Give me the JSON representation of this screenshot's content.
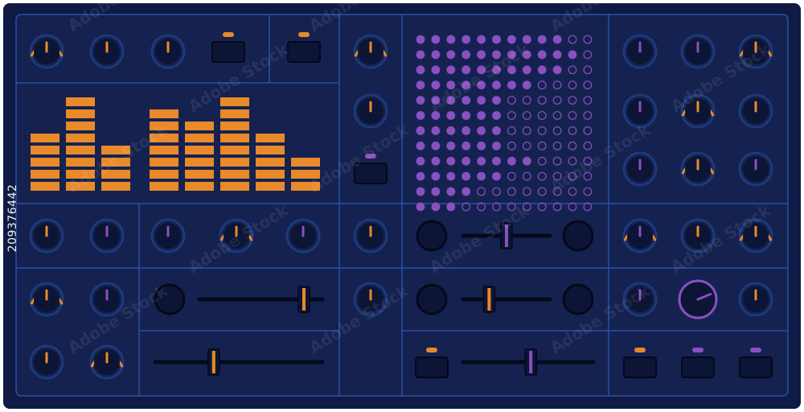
{
  "stock_id": "209376442",
  "watermark": "Adobe Stock",
  "colors": {
    "panel": "#152250",
    "frame": "#0f1b45",
    "line": "#2a4fa8",
    "knob_ring": "#1c3a7c",
    "knob_body": "#0c1535",
    "orange": "#e88a2a",
    "purple": "#8a50c0",
    "slider_track": "#06091c"
  },
  "equalizer": {
    "levels": [
      5,
      8,
      4,
      7,
      6,
      8,
      5,
      3
    ],
    "max_segments": 8
  },
  "matrix": {
    "rows": 12,
    "cols": 12,
    "filled_per_row": [
      10,
      11,
      10,
      8,
      6,
      6,
      6,
      6,
      8,
      6,
      4,
      3
    ]
  },
  "knobs": [
    {
      "id": "k1",
      "accent": "orange",
      "value": 0.5
    },
    {
      "id": "k2",
      "accent": "orange",
      "value": 0.5
    },
    {
      "id": "k3",
      "accent": "orange",
      "value": 0.5
    },
    {
      "id": "k4",
      "accent": "orange",
      "value": 0.5
    },
    {
      "id": "k5",
      "accent": "orange",
      "value": 0.5
    },
    {
      "id": "k6",
      "accent": "purple",
      "value": 0.5
    },
    {
      "id": "k7",
      "accent": "purple",
      "value": 0.5
    },
    {
      "id": "k8",
      "accent": "orange",
      "value": 0.5
    },
    {
      "id": "k9",
      "accent": "purple",
      "value": 0.5
    },
    {
      "id": "k10",
      "accent": "orange",
      "value": 0.5
    },
    {
      "id": "k11",
      "accent": "orange",
      "value": 0.5
    },
    {
      "id": "k12",
      "accent": "purple",
      "value": 0.5
    },
    {
      "id": "k13",
      "accent": "orange",
      "value": 0.5
    },
    {
      "id": "k14",
      "accent": "purple",
      "value": 0.5
    },
    {
      "id": "k15",
      "accent": "orange",
      "value": 0.5
    },
    {
      "id": "k16",
      "accent": "purple",
      "value": 0.5
    },
    {
      "id": "k17",
      "accent": "purple",
      "value": 0.5
    },
    {
      "id": "k18",
      "accent": "orange",
      "value": 0.5
    },
    {
      "id": "k19",
      "accent": "purple",
      "value": 0.5
    },
    {
      "id": "k20",
      "accent": "orange",
      "value": 0.5
    },
    {
      "id": "k21",
      "accent": "purple",
      "value": 0.5
    },
    {
      "id": "k22",
      "accent": "orange",
      "value": 0.5
    },
    {
      "id": "k23",
      "accent": "orange",
      "value": 0.5
    },
    {
      "id": "k24",
      "accent": "orange",
      "value": 0.5
    },
    {
      "id": "k25",
      "accent": "purple",
      "value": 0.5
    },
    {
      "id": "k26",
      "accent": "orange",
      "value": 0.5
    },
    {
      "id": "k27",
      "accent": "purple",
      "value": 0.5
    },
    {
      "id": "k28",
      "accent": "orange",
      "value": 0.5
    },
    {
      "id": "k29",
      "accent": "orange",
      "value": 0.5
    },
    {
      "id": "k30",
      "accent": "orange",
      "value": 0.5
    }
  ],
  "sliders": [
    {
      "id": "s1",
      "accent": "purple",
      "value": 0.5
    },
    {
      "id": "s2",
      "accent": "orange",
      "value": 0.85
    },
    {
      "id": "s3",
      "accent": "orange",
      "value": 0.3
    },
    {
      "id": "s4",
      "accent": "orange",
      "value": 0.35
    },
    {
      "id": "s5",
      "accent": "purple",
      "value": 0.52
    }
  ],
  "buttons": [
    {
      "id": "b1",
      "led": "orange"
    },
    {
      "id": "b2",
      "led": "orange"
    },
    {
      "id": "b3",
      "led": "purple"
    },
    {
      "id": "b4",
      "led": "orange"
    },
    {
      "id": "b5",
      "led": "orange"
    },
    {
      "id": "b6",
      "led": "purple"
    },
    {
      "id": "b7",
      "led": "purple"
    }
  ],
  "pads": [
    "p1",
    "p2",
    "p3",
    "p4",
    "p5",
    "p6"
  ],
  "large_knob": {
    "accent": "purple",
    "value": 0.75
  }
}
